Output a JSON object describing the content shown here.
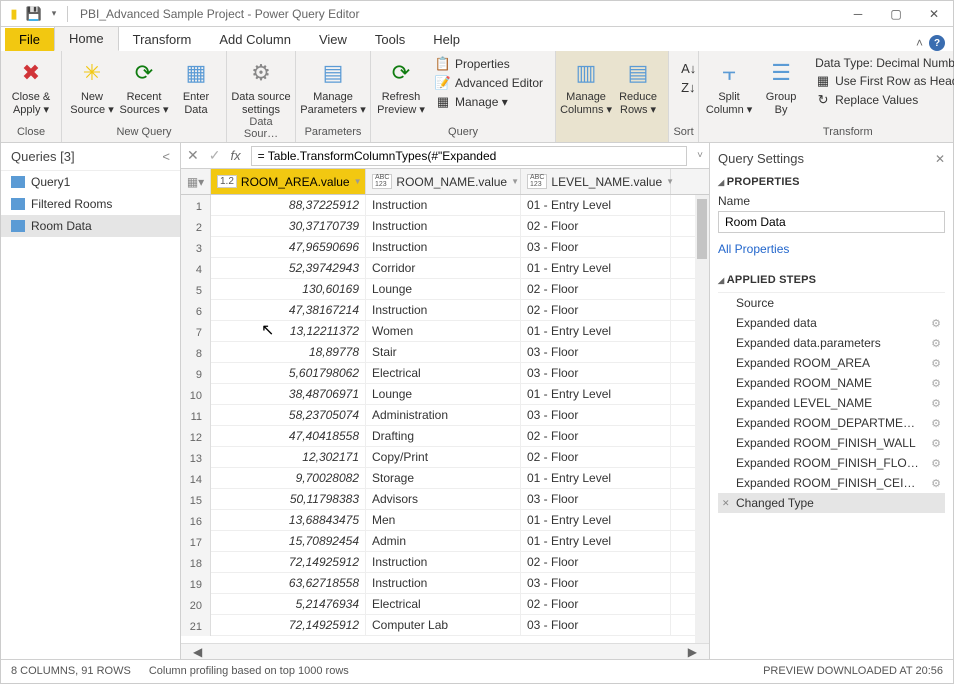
{
  "window": {
    "title": "PBI_Advanced Sample Project - Power Query Editor"
  },
  "tabs": {
    "file": "File",
    "home": "Home",
    "transform": "Transform",
    "add": "Add Column",
    "view": "View",
    "tools": "Tools",
    "help": "Help"
  },
  "ribbon": {
    "close_apply": "Close &\nApply ▾",
    "new_source": "New\nSource ▾",
    "recent_sources": "Recent\nSources ▾",
    "enter_data": "Enter\nData",
    "data_source": "Data source\nsettings",
    "manage_params": "Manage\nParameters ▾",
    "refresh": "Refresh\nPreview ▾",
    "properties": "Properties",
    "adv_editor": "Advanced Editor",
    "manage": "Manage ▾",
    "manage_cols": "Manage\nColumns ▾",
    "reduce_rows": "Reduce\nRows ▾",
    "split_col": "Split\nColumn ▾",
    "group_by": "Group\nBy",
    "data_type": "Data Type: Decimal Number ▾",
    "first_row": "Use First Row as Headers ▾",
    "replace": "Replace Values",
    "g_close": "Close",
    "g_newquery": "New Query",
    "g_datasources": "Data Sour…",
    "g_params": "Parameters",
    "g_query": "Query",
    "g_sort": "Sort",
    "g_transform": "Transform"
  },
  "queries": {
    "header": "Queries [3]",
    "items": [
      "Query1",
      "Filtered Rooms",
      "Room Data"
    ]
  },
  "fx": {
    "formula": "= Table.TransformColumnTypes(#\"Expanded"
  },
  "columns": {
    "col1": "ROOM_AREA.value",
    "col2": "ROOM_NAME.value",
    "col3": "LEVEL_NAME.value",
    "type_num": "1.2",
    "type_abc": "ABC\n123"
  },
  "rows": [
    {
      "n": "1",
      "area": "88,37225912",
      "name": "Instruction",
      "level": "01 - Entry Level"
    },
    {
      "n": "2",
      "area": "30,37170739",
      "name": "Instruction",
      "level": "02 - Floor"
    },
    {
      "n": "3",
      "area": "47,96590696",
      "name": "Instruction",
      "level": "03 - Floor"
    },
    {
      "n": "4",
      "area": "52,39742943",
      "name": "Corridor",
      "level": "01 - Entry Level"
    },
    {
      "n": "5",
      "area": "130,60169",
      "name": "Lounge",
      "level": "02 - Floor"
    },
    {
      "n": "6",
      "area": "47,38167214",
      "name": "Instruction",
      "level": "02 - Floor"
    },
    {
      "n": "7",
      "area": "13,12211372",
      "name": "Women",
      "level": "01 - Entry Level"
    },
    {
      "n": "8",
      "area": "18,89778",
      "name": "Stair",
      "level": "03 - Floor"
    },
    {
      "n": "9",
      "area": "5,601798062",
      "name": "Electrical",
      "level": "03 - Floor"
    },
    {
      "n": "10",
      "area": "38,48706971",
      "name": "Lounge",
      "level": "01 - Entry Level"
    },
    {
      "n": "11",
      "area": "58,23705074",
      "name": "Administration",
      "level": "03 - Floor"
    },
    {
      "n": "12",
      "area": "47,40418558",
      "name": "Drafting",
      "level": "02 - Floor"
    },
    {
      "n": "13",
      "area": "12,302171",
      "name": "Copy/Print",
      "level": "02 - Floor"
    },
    {
      "n": "14",
      "area": "9,70028082",
      "name": "Storage",
      "level": "01 - Entry Level"
    },
    {
      "n": "15",
      "area": "50,11798383",
      "name": "Advisors",
      "level": "03 - Floor"
    },
    {
      "n": "16",
      "area": "13,68843475",
      "name": "Men",
      "level": "01 - Entry Level"
    },
    {
      "n": "17",
      "area": "15,70892454",
      "name": "Admin",
      "level": "01 - Entry Level"
    },
    {
      "n": "18",
      "area": "72,14925912",
      "name": "Instruction",
      "level": "02 - Floor"
    },
    {
      "n": "19",
      "area": "63,62718558",
      "name": "Instruction",
      "level": "03 - Floor"
    },
    {
      "n": "20",
      "area": "5,21476934",
      "name": "Electrical",
      "level": "02 - Floor"
    },
    {
      "n": "21",
      "area": "72,14925912",
      "name": "Computer Lab",
      "level": "03 - Floor"
    }
  ],
  "settings": {
    "title": "Query Settings",
    "properties": "PROPERTIES",
    "name_label": "Name",
    "name_value": "Room Data",
    "all_props": "All Properties",
    "applied_steps": "APPLIED STEPS",
    "steps": [
      {
        "t": "Source",
        "g": false
      },
      {
        "t": "Expanded data",
        "g": true
      },
      {
        "t": "Expanded data.parameters",
        "g": true
      },
      {
        "t": "Expanded ROOM_AREA",
        "g": true
      },
      {
        "t": "Expanded ROOM_NAME",
        "g": true
      },
      {
        "t": "Expanded LEVEL_NAME",
        "g": true
      },
      {
        "t": "Expanded ROOM_DEPARTME…",
        "g": true
      },
      {
        "t": "Expanded ROOM_FINISH_WALL",
        "g": true
      },
      {
        "t": "Expanded ROOM_FINISH_FLO…",
        "g": true
      },
      {
        "t": "Expanded ROOM_FINISH_CEI…",
        "g": true
      },
      {
        "t": "Changed Type",
        "g": false,
        "sel": true
      }
    ]
  },
  "status": {
    "left": "8 COLUMNS, 91 ROWS",
    "mid": "Column profiling based on top 1000 rows",
    "right": "PREVIEW DOWNLOADED AT 20:56"
  }
}
